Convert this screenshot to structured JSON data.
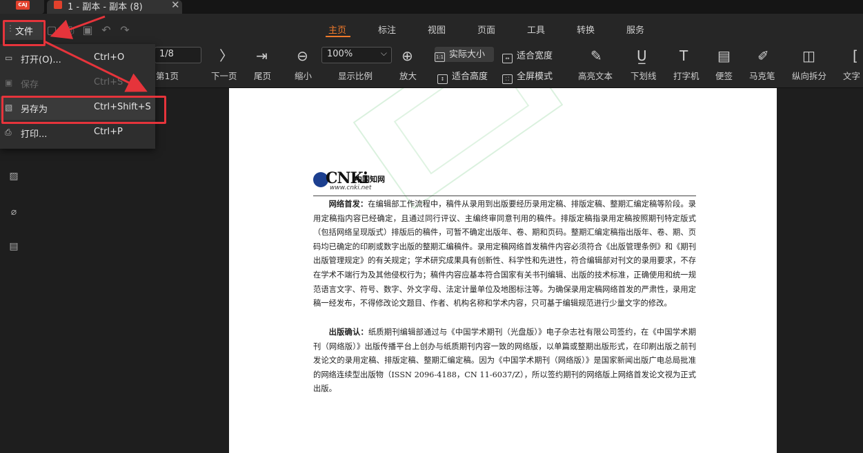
{
  "app": {
    "logo_text": "CAJ",
    "tab_title": "1 - 副本 - 副本 (8)",
    "tab_close": "✕"
  },
  "menu": {
    "file_label": "文件",
    "tabs": [
      "主页",
      "标注",
      "视图",
      "页面",
      "工具",
      "转换",
      "服务"
    ],
    "active_tab": "主页",
    "accent_color": "#f07a2b"
  },
  "toolbar": {
    "page_current": "1/8",
    "first_page_label": "第1页",
    "next_page_label": "下一页",
    "last_page_label": "尾页",
    "zoom_out_label": "缩小",
    "zoom_value": "100%",
    "zoom_ratio_label": "显示比例",
    "zoom_in_label": "放大",
    "actual_size_label": "实际大小",
    "fit_width_label": "适合宽度",
    "fit_height_label": "适合高度",
    "fullscreen_label": "全屏模式",
    "highlight_label": "高亮文本",
    "underline_label": "下划线",
    "typewriter_label": "打字机",
    "note_label": "便签",
    "marker_label": "马克笔",
    "split_label": "纵向拆分",
    "text_label": "文字"
  },
  "file_menu": {
    "items": [
      {
        "label": "打开(O)...",
        "shortcut": "Ctrl+O",
        "enabled": true
      },
      {
        "label": "保存",
        "shortcut": "Ctrl+S",
        "enabled": false
      },
      {
        "label": "另存为",
        "shortcut": "Ctrl+Shift+S",
        "enabled": true
      },
      {
        "label": "打印...",
        "shortcut": "Ctrl+P",
        "enabled": true
      }
    ]
  },
  "document": {
    "logo_brand": "CNKi",
    "logo_cn": "中国知网",
    "logo_url": "www.cnki.net",
    "para1_lead": "网络首发：",
    "para1_body": "在编辑部工作流程中，稿件从录用到出版要经历录用定稿、排版定稿、整期汇编定稿等阶段。录用定稿指内容已经确定，且通过同行评议、主编终审同意刊用的稿件。排版定稿指录用定稿按照期刊特定版式（包括网络呈现版式）排版后的稿件，可暂不确定出版年、卷、期和页码。整期汇编定稿指出版年、卷、期、页码均已确定的印刷或数字出版的整期汇编稿件。录用定稿网络首发稿件内容必须符合《出版管理条例》和《期刊出版管理规定》的有关规定；学术研究成果具有创新性、科学性和先进性，符合编辑部对刊文的录用要求，不存在学术不端行为及其他侵权行为；稿件内容应基本符合国家有关书刊编辑、出版的技术标准，正确使用和统一规范语言文字、符号、数字、外文字母、法定计量单位及地图标注等。为确保录用定稿网络首发的严肃性，录用定稿一经发布，不得修改论文题目、作者、机构名称和学术内容，只可基于编辑规范进行少量文字的修改。",
    "para2_lead": "出版确认：",
    "para2_body": "纸质期刊编辑部通过与《中国学术期刊（光盘版）》电子杂志社有限公司签约，在《中国学术期刊（网络版）》出版传播平台上创办与纸质期刊内容一致的网络版，以单篇或整期出版形式，在印刷出版之前刊发论文的录用定稿、排版定稿、整期汇编定稿。因为《中国学术期刊（网络版）》是国家新闻出版广电总局批准的网络连续型出版物（ISSN 2096-4188，CN 11-6037/Z），所以签约期刊的网络版上网络首发论文视为正式出版。"
  }
}
